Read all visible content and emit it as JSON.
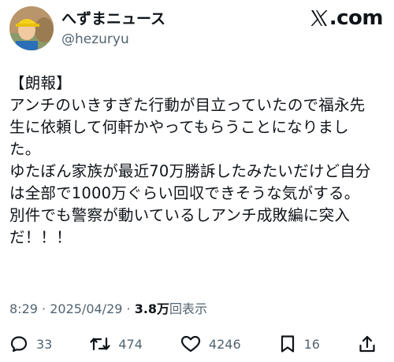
{
  "header": {
    "display_name": "へずまニュース",
    "handle": "@hezuryu",
    "brand_text": ".com"
  },
  "post": {
    "text": "【朗報】\nアンチのいきすぎた行動が目立っていたので福永先\n生に依頼して何軒かやってもらうことになりまし\nた。\nゆたぼん家族が最近70万勝訴したみたいだけど自分\nは全部で1000万ぐらい回収できそうな気がする。\n別件でも警察が動いているしアンチ成敗編に突入\nだ！！！"
  },
  "meta": {
    "time": "8:29",
    "separator": " · ",
    "date": "2025/04/29",
    "views_count": "3.8万",
    "views_label": "回表示"
  },
  "actions": {
    "replies": "33",
    "reposts": "474",
    "likes": "4246",
    "bookmarks": "16"
  },
  "icons": [
    "avatar-image",
    "x-logo-icon",
    "reply-icon",
    "repost-icon",
    "like-icon",
    "bookmark-icon",
    "share-icon"
  ],
  "colors": {
    "text": "#0f1419",
    "secondary": "#536471",
    "background": "#ffffff"
  }
}
